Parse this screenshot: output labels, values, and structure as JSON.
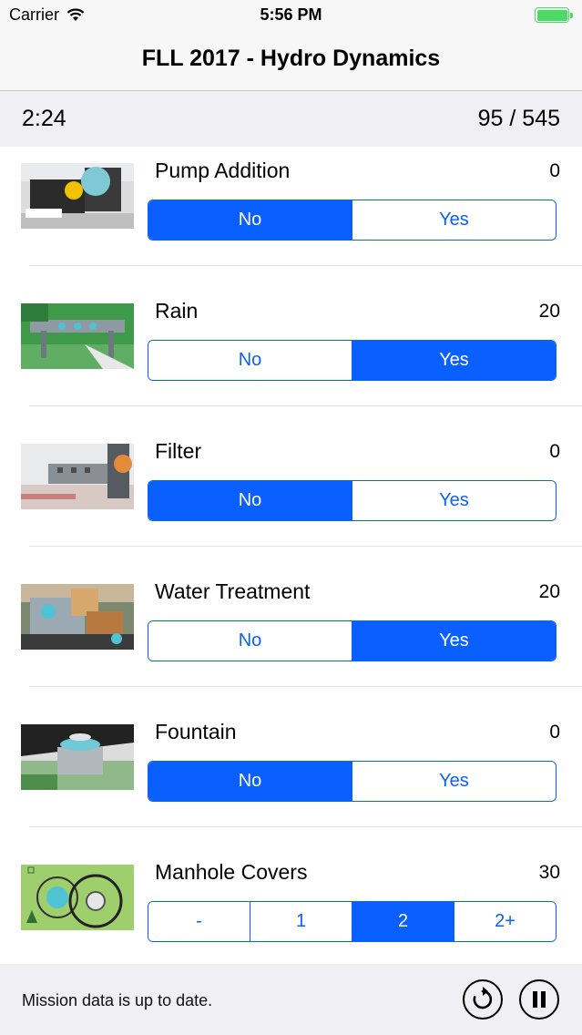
{
  "status_bar": {
    "carrier": "Carrier",
    "time": "5:56 PM",
    "battery_color": "#4cd964"
  },
  "nav": {
    "title": "FLL 2017 - Hydro Dynamics"
  },
  "info": {
    "timer": "2:24",
    "score": "95 / 545"
  },
  "missions": [
    {
      "name": "Pump Addition",
      "points": "0",
      "image": "pump-addition-photo",
      "options": [
        "No",
        "Yes"
      ],
      "selected": "No"
    },
    {
      "name": "Rain",
      "points": "20",
      "image": "rain-photo",
      "options": [
        "No",
        "Yes"
      ],
      "selected": "Yes"
    },
    {
      "name": "Filter",
      "points": "0",
      "image": "filter-photo",
      "options": [
        "No",
        "Yes"
      ],
      "selected": "No"
    },
    {
      "name": "Water Treatment",
      "points": "20",
      "image": "water-treatment-photo",
      "options": [
        "No",
        "Yes"
      ],
      "selected": "Yes"
    },
    {
      "name": "Fountain",
      "points": "0",
      "image": "fountain-photo",
      "options": [
        "No",
        "Yes"
      ],
      "selected": "No"
    },
    {
      "name": "Manhole Covers",
      "points": "30",
      "image": "manhole-covers-photo",
      "options": [
        "-",
        "1",
        "2",
        "2+"
      ],
      "selected": "2"
    }
  ],
  "bottom": {
    "status_text": "Mission data is up to date.",
    "reset_icon": "reset-icon",
    "pause_icon": "pause-icon"
  },
  "colors": {
    "accent": "#0a60ff",
    "bar_background": "#efeff4"
  }
}
